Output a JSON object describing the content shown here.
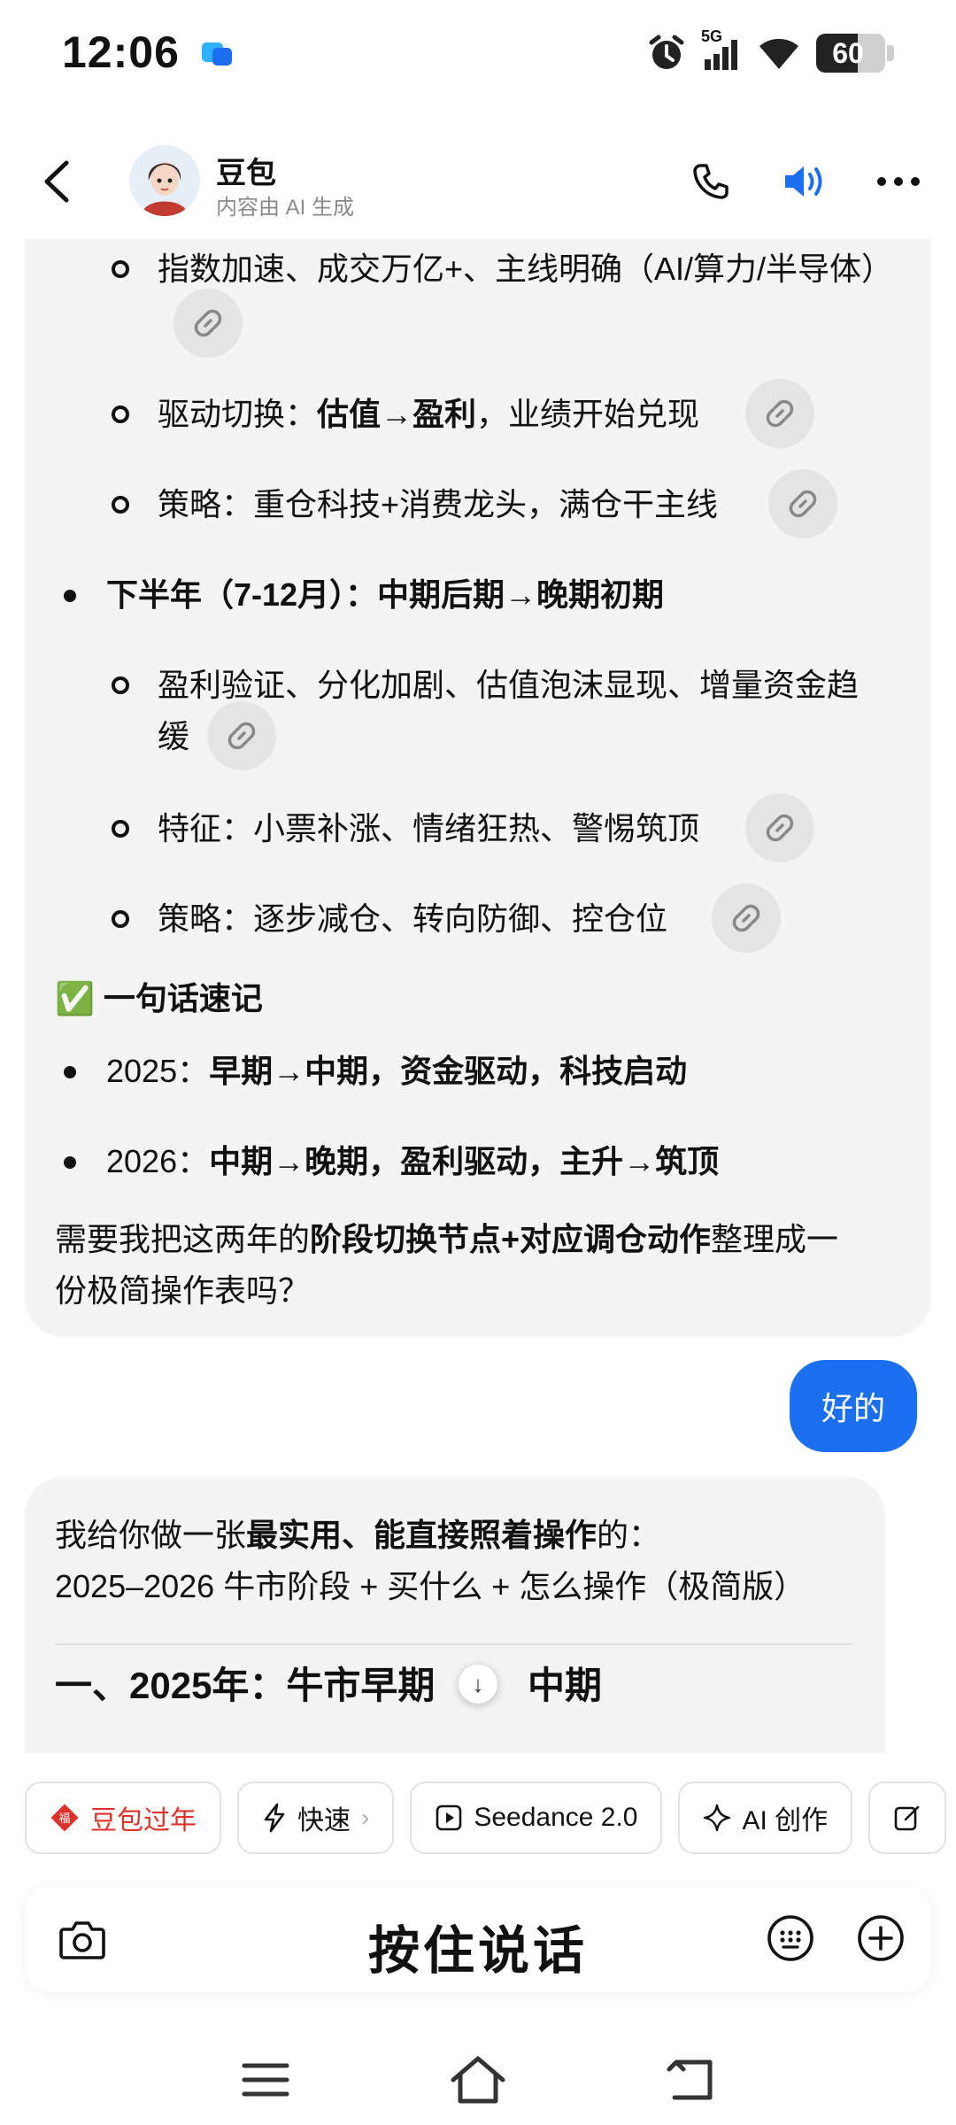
{
  "status_bar": {
    "time": "12:06",
    "network": "5G",
    "battery_level": "60"
  },
  "header": {
    "bot_name": "豆包",
    "subtitle": "内容由 AI 生成"
  },
  "messages": {
    "bot_1": {
      "b1": {
        "pre": "指数加速、成交万亿+、主线明确（AI/算力/半导体）"
      },
      "b2": {
        "pre": "驱动切换：",
        "bold": "估值→盈利",
        "post": "，业绩开始兑现"
      },
      "b3": {
        "pre": "策略：重仓科技+消费龙头，满仓干主线"
      },
      "h2": {
        "bold": "下半年（7-12月）：中期后期→晚期初期"
      },
      "b4": {
        "line1": "盈利验证、分化加剧、估值泡沫显现、增量资金趋",
        "line2": "缓"
      },
      "b5": {
        "pre": "特征：小票补涨、情绪狂热、警惕筑顶"
      },
      "b6": {
        "pre": "策略：逐步减仓、转向防御、控仓位"
      },
      "summary_icon": "✅",
      "summary_title": "一句话速记",
      "s1": {
        "pre": "2025：",
        "bold": "早期→中期，资金驱动，科技启动"
      },
      "s2": {
        "pre": "2026：",
        "bold": "中期→晚期，盈利驱动，主升→筑顶"
      },
      "closing": {
        "pre": "需要我把这两年的",
        "bold": "阶段切换节点+对应调仓动作",
        "post": "整理成一",
        "line2": "份极简操作表吗？"
      }
    },
    "user_1": "好的",
    "bot_2": {
      "intro_pre": "我给你做一张",
      "intro_bold": "最实用、能直接照着操作",
      "intro_post": "的：",
      "intro_line2": "2025–2026 牛市阶段 + 买什么 + 怎么操作（极简版）",
      "section_title_a": "一、2025年：牛市早期",
      "section_title_b": "中期"
    }
  },
  "chips": [
    {
      "label": "豆包过年",
      "icon": "lucky-icon"
    },
    {
      "label": "快速",
      "icon": "lightning-icon"
    },
    {
      "label": "Seedance 2.0",
      "icon": "video-play-icon"
    },
    {
      "label": "AI 创作",
      "icon": "sparkle-icon"
    },
    {
      "label": "",
      "icon": "edit-icon"
    }
  ],
  "input": {
    "hold_to_talk": "按住说话"
  },
  "colors": {
    "accent": "#1d6ff2",
    "bubble_bg": "#f4f4f4",
    "red": "#e0322a"
  }
}
